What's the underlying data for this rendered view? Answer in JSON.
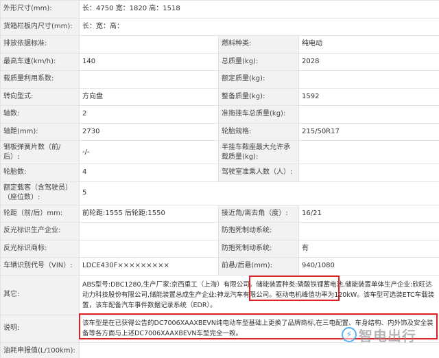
{
  "rows": [
    {
      "l1": "外形尺寸(mm):",
      "v1": "长：4750 宽：1820 高：1518"
    },
    {
      "l1": "货箱栏板内尺寸(mm):",
      "v1": "长：宽：高："
    },
    {
      "l1": "排放依据标准:",
      "v1": "",
      "l2": "燃料种类:",
      "v2": "纯电动"
    },
    {
      "l1": "最高车速(km/h):",
      "v1": "140",
      "l2": "总质量(kg):",
      "v2": "2028"
    },
    {
      "l1": "载质量利用系数:",
      "v1": "",
      "l2": "额定质量(kg):",
      "v2": ""
    },
    {
      "l1": "转向型式:",
      "v1": "方向盘",
      "l2": "整备质量(kg):",
      "v2": "1592"
    },
    {
      "l1": "轴数:",
      "v1": "2",
      "l2": "准拖挂车总质量(kg):",
      "v2": ""
    },
    {
      "l1": "轴距(mm):",
      "v1": "2730",
      "l2": "轮胎规格:",
      "v2": "215/50R17"
    },
    {
      "l1": "钢板弹簧片数（前/后）:",
      "v1": "-/-",
      "l2": "半挂车鞍座最大允许承载质量(kg):",
      "v2": ""
    },
    {
      "l1": "轮胎数:",
      "v1": "4",
      "l2": "驾驶室准乘人数（人）:",
      "v2": ""
    },
    {
      "l1": "额定载客（含驾驶员）（座位数）:",
      "v1": "5"
    },
    {
      "l1": "轮距（前/后）mm:",
      "v1": "前轮距:1555 后轮距:1550",
      "l2": "接近角/离去角（度）:",
      "v2": "16/21"
    },
    {
      "l1": "反光标识生产企业:",
      "v1": "",
      "l2": "防抱死制动系统:",
      "v2": ""
    },
    {
      "l1": "反光标识商标:",
      "v1": "",
      "l2": "防抱死制动系统:",
      "v2": "有"
    },
    {
      "l1": "车辆识别代号（VIN）:",
      "v1": "LDCE430F×××××××××",
      "l2": "前悬/后悬(mm):",
      "v2": "940/1080"
    },
    {
      "l1": "其它:",
      "v1": "ABS型号:DBC1280,生产厂家:京西重工（上海）有限公司。储能装置种类:磷酸铁锂蓄电池,储能装置单体生产企业:欣旺达动力科技股份有限公司,储能装置总成生产企业:神龙汽车有限公司。驱动电机峰值功率为120kW。该车型可选装ETC车载装置，该车配备汽车事件数据记录系统（EDR）。"
    },
    {
      "l1": "说明:",
      "v1": "该车型是在已获得公告的DC7006XAAXBEVN纯电动车型基础上更换了品牌商标,在三电配置、车身结构、内外饰及安全装备等各方面与上述DC7006XAAXBEVN车型完全一致。"
    },
    {
      "l1": "油耗申报值(L/100km):",
      "v1": ""
    }
  ],
  "watermark": {
    "icon": "lightning-icon",
    "text": "智电出行"
  },
  "colors": {
    "label_bg": "#f2f2f2",
    "border": "#e3e3e3",
    "highlight": "#e02020"
  }
}
